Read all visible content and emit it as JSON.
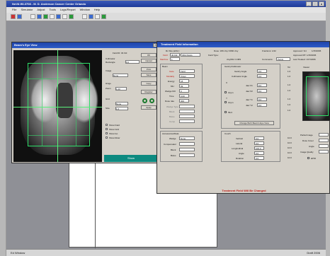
{
  "app": {
    "title": "NoVA WL3708 - M. D. Anderson Cancer Center Orlando",
    "menu": [
      "File",
      "Simulator",
      "Adjust",
      "Tools",
      "Logs/Report",
      "Window",
      "Help"
    ],
    "status_left": "Ed Window",
    "status_right": "Draft 2006"
  },
  "bev": {
    "title": "Beam's Eye View",
    "close_glyph": "X",
    "field_id_label": "Field ID: 3b Fld",
    "collimator_label": "Collimator",
    "rectangle_label": "Rectangle",
    "rectangle_value": "0.0",
    "image_label": "Image",
    "image_value": "None",
    "hinge_label": "Hinge",
    "zoom_label": "Zoom",
    "zoom_value": "1.00",
    "grid_label": "Grid",
    "grid_value": "None",
    "grid_size_label": "Size",
    "grid_size_value": "1.0",
    "checks": [
      "Show Field",
      "Show Grid",
      "Show Iso",
      "Show Ruler"
    ],
    "buttons": [
      "OK",
      "Cancel",
      "Print",
      "Save",
      "Copy",
      "Register",
      "Apply"
    ],
    "footer_label": "Show"
  },
  "tfi": {
    "title": "Treatment Field Information",
    "header": {
      "rx_label": "Rx Site (abbr.):",
      "rx_value": "",
      "field_label": "Field",
      "field_value": "3b Fld",
      "field_name_value": "3Fld Pelvis",
      "machine_label": "Machine",
      "machine_value": "1",
      "dose_label": "Dose: 180 cGy/ 3960 cGy",
      "fractions_label": "Fractions: 1/22",
      "approved_label": "Approved: VH",
      "approved_date": "1/15/2006",
      "field_type_label": "Field Type:",
      "approved_rt": "Approved RT: 1/15/2006",
      "last_treated": "Last Treated: 1/17/2006",
      "ssd_label": "cGy/MU: 0.983",
      "comments_label": "Comments:",
      "comments_value": "Pelvis"
    },
    "beam": {
      "group_label": "Beam",
      "gate_label": "Gate",
      "gate_value": "Field",
      "modality_label": "Modality",
      "modality_value": "Xrays",
      "energy_label": "Energy",
      "energy_value": "18",
      "mu_label": "MU",
      "mu_value": "99",
      "wedge_label": "Wedge MU",
      "wedge_value": "0",
      "time_label": "Time",
      "time_value": "0.00",
      "dose_rate_label": "Dose rate",
      "dose_rate_value": "300",
      "extra_labels": [
        "Wedge Type",
        "Block",
        "Bolus",
        "Comp"
      ],
      "extra_values": [
        "",
        "",
        "",
        ""
      ]
    },
    "gantry": {
      "group_label": "Gantry/Collimator",
      "gantry_angle_label": "Gantry Angle",
      "gantry_angle_value": "0.0",
      "coll_angle_label": "Collimator Angle",
      "coll_angle_value": "0.0",
      "x_label": "X",
      "y_label": "Y",
      "checks": [
        "Asym",
        "Asym",
        "MLC"
      ],
      "jaw_labels": [
        "Jaw X1",
        "Jaw X2",
        "Jaw Y1",
        "Jaw Y2"
      ],
      "jaw_values": [
        "8.0",
        "8.0",
        "8.0",
        "8.0"
      ],
      "change_btn": "Change Both Beam's Eye View"
    },
    "tol": {
      "header": "Tol",
      "values": [
        "1.0",
        "1.0",
        "1.0",
        "1.0",
        "1.0",
        "1.0",
        "1.0"
      ]
    },
    "accessories": {
      "group_label": "Accessories/Data",
      "wedge_label": "Wedge",
      "wedge_value": "None",
      "compensator_label": "Compensator",
      "compensator_value": "",
      "block_label": "Block",
      "block_value": "",
      "bolus_label": "Bolus",
      "bolus_value": ""
    },
    "couch": {
      "group_label": "Couch",
      "vertical_label": "Vertical",
      "vertical_value": "0.0",
      "lateral_label": "Lateral",
      "lateral_value": "0.0",
      "longitudinal_label": "Longitudinal",
      "longitudinal_value": "100.0",
      "angle_label": "Angle",
      "angle_value": "0.0",
      "rotation_label": "Rotation",
      "rotation_value": "0.0",
      "tol_values": [
        "10.0",
        "10.0",
        "10.0",
        "10.0",
        "10.0"
      ]
    },
    "right_panel": {
      "viewer_label": "Viewer",
      "partial_image_label": "Partial Image",
      "dose_cover_label": "Dose Cover",
      "angle_label": "Angle",
      "image_quality_label": "Image Quality",
      "epid_label": "EPID"
    },
    "footer": "Treatment Field Will Be Changed"
  }
}
